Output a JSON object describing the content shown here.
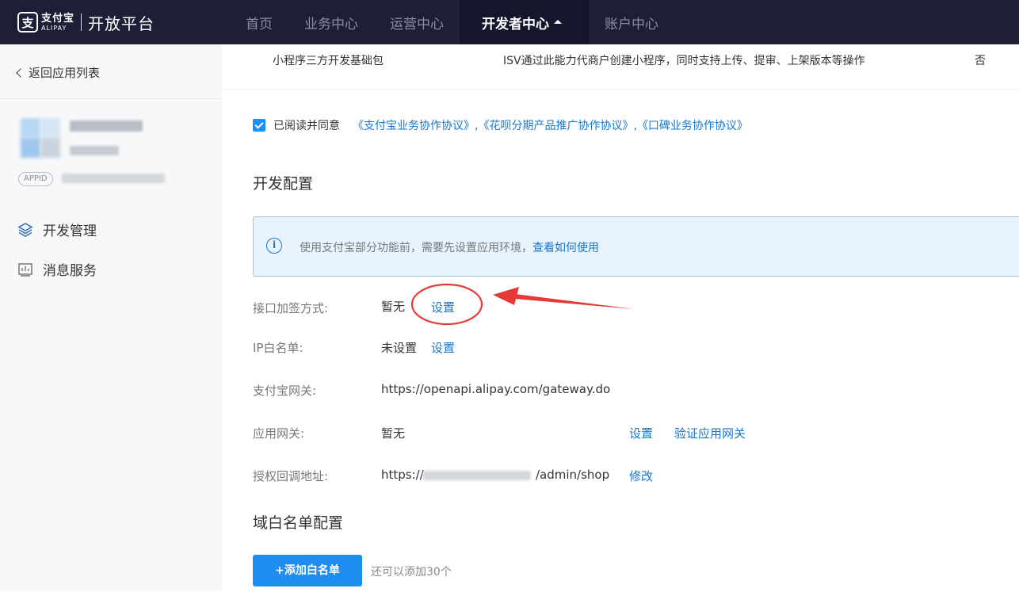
{
  "header": {
    "logo_cn": "支付宝",
    "logo_en": "ALIPAY",
    "platform_title": "开放平台",
    "nav": [
      "首页",
      "业务中心",
      "运营中心",
      "开发者中心",
      "账户中心"
    ],
    "active_nav_index": 3
  },
  "sidebar": {
    "back_label": "返回应用列表",
    "appid_badge": "APPID",
    "menu": [
      {
        "label": "开发管理",
        "icon": "layers-icon"
      },
      {
        "label": "消息服务",
        "icon": "chart-icon"
      }
    ]
  },
  "top_row": {
    "name": "小程序三方开发基础包",
    "description": "ISV通过此能力代商户创建小程序，同时支持上传、提审、上架版本等操作",
    "flag": "否"
  },
  "agreement": {
    "checked": true,
    "label": "已阅读并同意",
    "links": "《支付宝业务协作协议》,《花呗分期产品推广协作协议》,《口碑业务协作协议》"
  },
  "dev_config": {
    "title": "开发配置",
    "notice": "使用支付宝部分功能前，需要先设置应用环境，",
    "notice_link": "查看如何使用",
    "fields": [
      {
        "label": "接口加签方式:",
        "value": "暂无",
        "actions": [
          "设置"
        ]
      },
      {
        "label": "IP白名单:",
        "value": "未设置",
        "actions": [
          "设置"
        ]
      },
      {
        "label": "支付宝网关:",
        "value": "https://openapi.alipay.com/gateway.do",
        "actions": []
      },
      {
        "label": "应用网关:",
        "value": "暂无",
        "actions": [
          "设置",
          "验证应用网关"
        ]
      },
      {
        "label": "授权回调地址:",
        "value_prefix": "https://",
        "value_suffix": "/admin/shop",
        "actions": [
          "修改"
        ]
      }
    ]
  },
  "domain_whitelist": {
    "title": "域白名单配置",
    "add_button": "+添加白名单",
    "hint": "还可以添加30个"
  },
  "colors": {
    "header_bg": "#1c1f36",
    "accent": "#1677cc",
    "button": "#1f8cf0",
    "annotation": "#e53935"
  }
}
